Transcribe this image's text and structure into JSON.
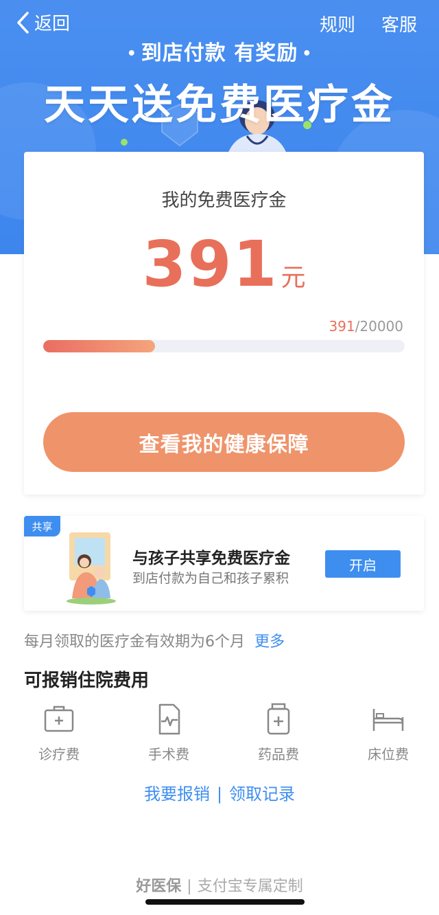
{
  "nav": {
    "back_label": "返回",
    "rules_label": "规则",
    "service_label": "客服"
  },
  "hero": {
    "subtitle": "到店付款 有奖励",
    "title": "天天送免费医疗金",
    "dot": "•"
  },
  "card": {
    "label": "我的免费医疗金",
    "amount": "391",
    "unit": "元",
    "progress_current": "391",
    "progress_total": "/20000",
    "progress_fraction": 0.31,
    "cta_label": "查看我的健康保障"
  },
  "share": {
    "tag": "共享",
    "title": "与孩子共享免费医疗金",
    "desc": "到店付款为自己和孩子累积",
    "button_label": "开启"
  },
  "validity": {
    "text": "每月领取的医疗金有效期为6个月",
    "more": "更多"
  },
  "section": {
    "title": "可报销住院费用"
  },
  "categories": [
    {
      "label": "诊疗费",
      "icon": "medical-kit-icon"
    },
    {
      "label": "手术费",
      "icon": "heartbeat-document-icon"
    },
    {
      "label": "药品费",
      "icon": "medicine-bottle-icon"
    },
    {
      "label": "床位费",
      "icon": "bed-icon"
    }
  ],
  "links": {
    "claim": "我要报销",
    "sep": "|",
    "records": "领取记录"
  },
  "footer": {
    "brand": "好医保",
    "sep": "|",
    "tagline": "支付宝专属定制"
  },
  "colors": {
    "primary_blue": "#3e8ef0",
    "accent_orange": "#ef936a",
    "amount_red": "#e8705a"
  }
}
